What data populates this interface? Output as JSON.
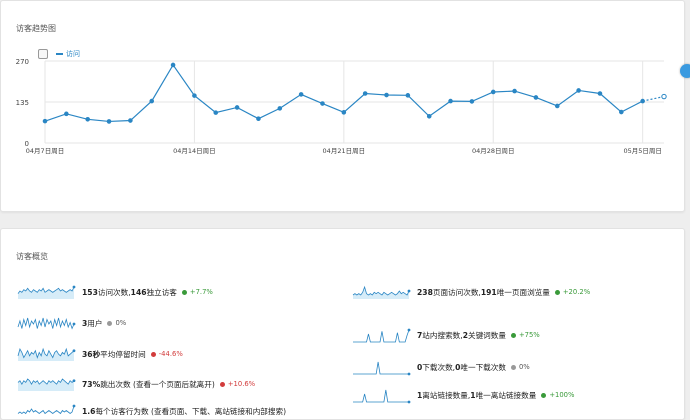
{
  "trend": {
    "title": "访客趋势图",
    "legend_label": "访问",
    "colors": {
      "line": "#2a86c4",
      "grid": "#e6e6e6",
      "axis_text": "#444"
    }
  },
  "side_tab_label": "",
  "chart_data": {
    "type": "line",
    "title": "",
    "xlabel": "",
    "ylabel": "",
    "ylim": [
      0,
      270
    ],
    "yticks": [
      0,
      135,
      270
    ],
    "xticks": [
      "04月7日周日",
      "04月14日周日",
      "04月21日周日",
      "04月28日周日",
      "05月5日周日"
    ],
    "series": [
      {
        "name": "访问",
        "values": [
          72,
          96,
          78,
          71,
          74,
          138,
          257,
          156,
          100,
          117,
          80,
          114,
          160,
          130,
          101,
          163,
          158,
          157,
          88,
          138,
          137,
          168,
          171,
          150,
          122,
          173,
          163,
          102,
          138,
          153
        ],
        "last_point_partial": true
      }
    ]
  },
  "overview": {
    "title": "访客概览",
    "colors": {
      "spark": "#2a86c4",
      "spark_fill": "#d6ecf8",
      "pos": "#3a9a3a",
      "neg": "#d23c3c",
      "neu": "#999999"
    },
    "metrics": [
      {
        "num1": "153",
        "t1": " 访问次数, ",
        "num2": "146",
        "t2": " 独立访客",
        "change": "+7.7%",
        "trend": "pos",
        "spark": [
          4,
          6,
          5,
          7,
          6,
          8,
          6,
          5,
          7,
          6,
          5,
          7,
          6,
          8,
          5,
          6,
          7,
          6,
          5,
          6,
          7,
          8,
          6,
          7,
          6,
          5,
          6,
          7,
          6,
          9
        ],
        "fill": true
      },
      {
        "num1": "238",
        "t1": " 页面访问次数, ",
        "num2": "191",
        "t2": " 唯一页面浏览量",
        "change": "+20.2%",
        "trend": "pos",
        "spark": [
          3,
          4,
          3,
          4,
          3,
          5,
          9,
          4,
          3,
          4,
          3,
          5,
          4,
          5,
          4,
          3,
          5,
          4,
          3,
          4,
          5,
          4,
          3,
          4,
          6,
          4,
          5,
          4,
          3,
          6
        ],
        "fill": true
      },
      {
        "num1": "3",
        "t1": " 用户",
        "num2": "",
        "t2": "",
        "change": "0%",
        "trend": "neu",
        "spark": [
          2,
          6,
          1,
          7,
          3,
          8,
          2,
          6,
          4,
          7,
          1,
          6,
          3,
          8,
          2,
          7,
          4,
          6,
          1,
          7,
          3,
          8,
          2,
          6,
          3,
          7,
          2,
          5,
          1,
          4
        ],
        "fill": false
      },
      {
        "num1": "7",
        "t1": " 站内搜索数, ",
        "num2": "2",
        "t2": " 关键词数量",
        "change": "+75%",
        "trend": "pos",
        "spark": [
          0,
          0,
          0,
          0,
          0,
          0,
          0,
          0,
          6,
          0,
          0,
          0,
          0,
          0,
          0,
          8,
          0,
          0,
          0,
          0,
          0,
          0,
          0,
          7,
          0,
          0,
          0,
          0,
          5,
          9
        ],
        "fill": false
      },
      {
        "num1": "36秒",
        "t1": " 平均停留时间",
        "num2": "",
        "t2": "",
        "change": "-44.6%",
        "trend": "neg",
        "spark": [
          3,
          7,
          5,
          2,
          4,
          6,
          3,
          5,
          4,
          6,
          2,
          5,
          3,
          7,
          4,
          3,
          6,
          4,
          2,
          5,
          6,
          4,
          3,
          5,
          4,
          7,
          3,
          4,
          5,
          6
        ],
        "fill": true
      },
      {
        "num1": "0",
        "t1": " 下载次数, ",
        "num2": "0",
        "t2": " 唯一下载次数",
        "change": "0%",
        "trend": "neu",
        "spark": [
          0,
          0,
          0,
          0,
          0,
          0,
          0,
          0,
          0,
          0,
          0,
          0,
          0,
          9,
          0,
          0,
          0,
          0,
          0,
          0,
          0,
          0,
          0,
          0,
          0,
          0,
          0,
          0,
          0,
          0
        ],
        "fill": false
      },
      {
        "num1": "73%",
        "t1": " 跳出次数 (查看一个页面后就离开)",
        "num2": "",
        "t2": "",
        "change": "+10.6%",
        "trend": "neg",
        "spark": [
          5,
          6,
          4,
          6,
          5,
          7,
          6,
          4,
          6,
          5,
          6,
          4,
          5,
          6,
          5,
          4,
          6,
          5,
          6,
          5,
          4,
          6,
          5,
          7,
          6,
          5,
          4,
          6,
          5,
          6
        ],
        "fill": true
      },
      {
        "num1": "1",
        "t1": " 离站链接数量, ",
        "num2": "1",
        "t2": " 唯一离站链接数量",
        "change": "+100%",
        "trend": "pos",
        "spark": [
          0,
          0,
          0,
          0,
          0,
          0,
          6,
          0,
          0,
          0,
          0,
          0,
          0,
          0,
          0,
          0,
          0,
          9,
          0,
          0,
          0,
          0,
          0,
          0,
          0,
          0,
          0,
          0,
          0,
          0
        ],
        "fill": false
      },
      {
        "num1": "1.6",
        "t1": " 每个访客行为数 (查看页面、下载、离站链接和内部搜索)",
        "num2": "",
        "t2": "",
        "change": "",
        "trend": "neu",
        "spark": [
          3,
          4,
          3,
          4,
          3,
          5,
          4,
          6,
          4,
          5,
          4,
          3,
          4,
          5,
          3,
          4,
          5,
          4,
          3,
          4,
          5,
          4,
          3,
          5,
          4,
          5,
          4,
          3,
          4,
          8
        ],
        "fill": false
      }
    ]
  }
}
